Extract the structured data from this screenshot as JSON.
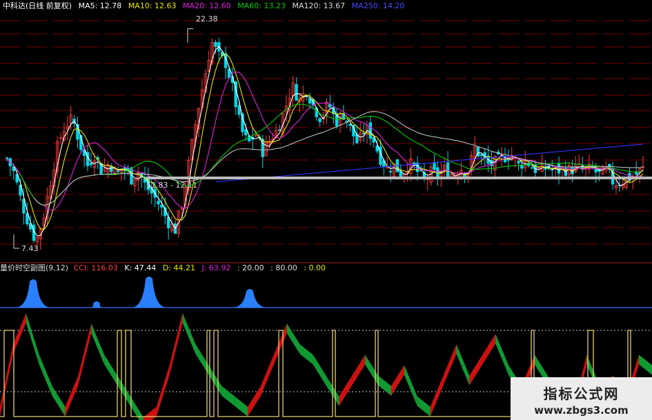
{
  "colors": {
    "bg": "#000000",
    "up": "#ff3c3c",
    "down": "#00d8e8",
    "ma5": "#ffffff",
    "ma10": "#e8e800",
    "ma20": "#e020e0",
    "ma60": "#00cc00",
    "ma120": "#bbbbbb",
    "ma250": "#3333ff",
    "red_area": "#cc1111",
    "green_area": "#119933",
    "blue_peak": "#2a7fff",
    "yellow_line": "#e8d070",
    "grid": "#7a0000",
    "support_line": "#bbbbbb"
  },
  "header": {
    "stock_name": "中科达(日线 前复权)",
    "ma5": "MA5: 12.78",
    "ma10": "MA10: 12.63",
    "ma20": "MA20: 12.60",
    "ma60": "MA60: 13.23",
    "ma120": "MA120: 13.67",
    "ma250": "MA250: 14.20"
  },
  "sub_header": {
    "name": "量价时空副图(9,12)",
    "cci": "CCI: 116.03",
    "k": "K: 47.44",
    "d": "D: 44.21",
    "j": "J: 63.92",
    "v1": ": 20.00",
    "v2": ": 80.00",
    "v3": ": 0.00"
  },
  "annotations": {
    "high": "22.38",
    "low": "7.43",
    "range": "11.83 - 12.11"
  },
  "watermark": {
    "line1": "指标公式网",
    "line2": "www.zbgs3.com"
  },
  "chart_data": {
    "type": "candlestick",
    "price_series": {
      "high_value": 22.38,
      "low_value": 7.43,
      "ma_last": {
        "MA5": 12.78,
        "MA10": 12.63,
        "MA20": 12.6,
        "MA60": 13.23,
        "MA120": 13.67,
        "MA250": 14.2
      },
      "close_path": [
        13.5,
        12.5,
        10.5,
        9.0,
        7.8,
        9.5,
        12.0,
        14.5,
        15.8,
        16.2,
        14.5,
        13.0,
        13.8,
        12.6,
        13.2,
        12.4,
        12.9,
        12.1,
        12.6,
        11.6,
        11.0,
        10.2,
        9.2,
        8.6,
        10.5,
        13.5,
        16.5,
        19.0,
        21.5,
        20.5,
        20.0,
        18.0,
        15.5,
        14.5,
        15.2,
        14.0,
        14.8,
        15.5,
        16.8,
        18.5,
        17.5,
        18.2,
        17.0,
        16.2,
        17.3,
        16.0,
        16.6,
        15.5,
        14.5,
        15.6,
        15.0,
        13.6,
        12.8,
        13.0,
        12.4,
        13.2,
        12.7,
        12.0,
        12.5,
        12.4,
        12.8,
        12.3,
        12.9,
        12.5,
        14.2,
        13.5,
        13.0,
        13.3,
        13.6,
        13.8,
        13.0,
        13.4,
        12.8,
        12.7,
        12.9,
        12.6,
        12.8,
        12.7,
        12.9,
        12.6,
        12.8,
        12.4,
        12.7,
        11.8,
        11.9,
        12.2,
        12.4,
        12.78
      ]
    },
    "sub_series": {
      "thresholds": [
        20,
        80,
        0
      ],
      "cci_last": 116.03,
      "k_last": 47.44,
      "d_last": 44.21,
      "j_last": 63.92,
      "osc_path": [
        10,
        70,
        100,
        60,
        30,
        10,
        40,
        90,
        60,
        40,
        20,
        0,
        10,
        50,
        100,
        70,
        50,
        30,
        20,
        10,
        30,
        60,
        90,
        70,
        60,
        40,
        20,
        40,
        60,
        40,
        30,
        50,
        20,
        10,
        40,
        70,
        40,
        60,
        80,
        50,
        30,
        60,
        40,
        20,
        10,
        60,
        30,
        40,
        20,
        60,
        50
      ]
    }
  }
}
